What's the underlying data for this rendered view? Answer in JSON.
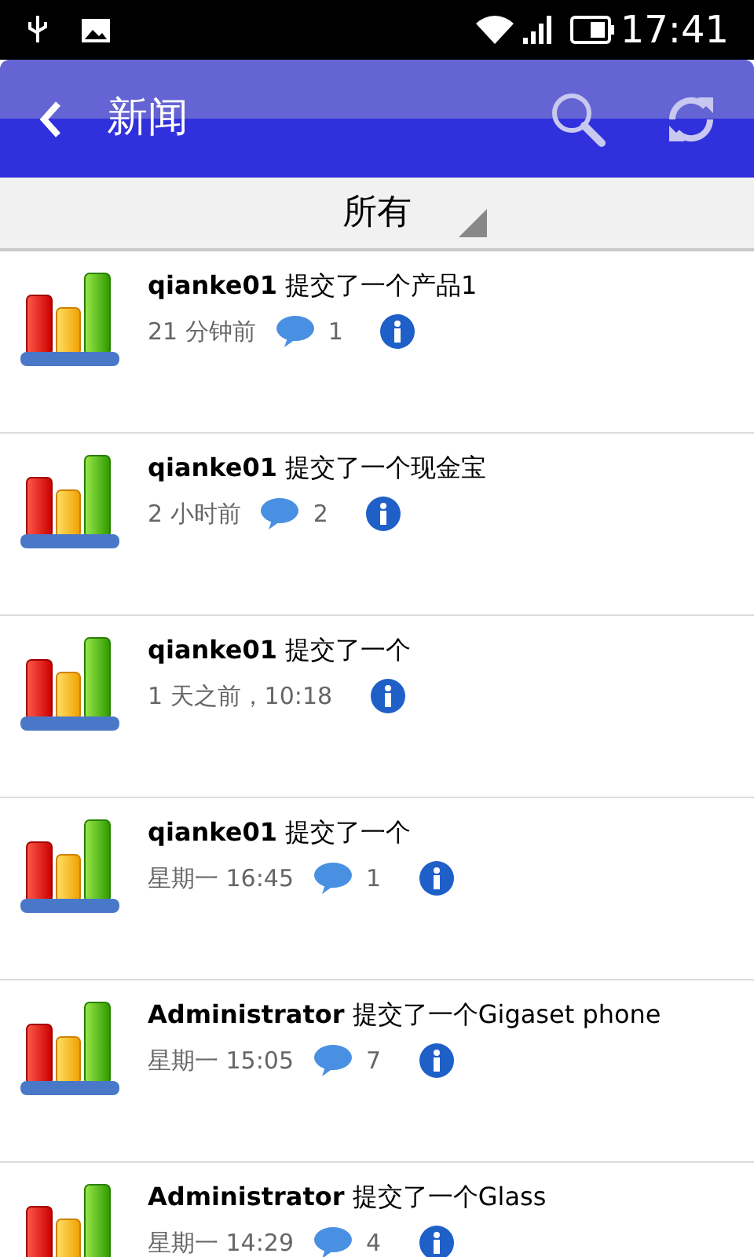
{
  "status_bar": {
    "time": "17:41"
  },
  "app_bar": {
    "title": "新闻"
  },
  "filter": {
    "value": "所有"
  },
  "items": [
    {
      "user": "qianke01",
      "action": "提交了一个产品1",
      "time": "21 分钟前",
      "comments": "1"
    },
    {
      "user": "qianke01",
      "action": "提交了一个现金宝",
      "time": "2 小时前",
      "comments": "2"
    },
    {
      "user": "qianke01",
      "action": "提交了一个",
      "time": "1 天之前，10:18"
    },
    {
      "user": "qianke01",
      "action": "提交了一个",
      "time": "星期一 16:45",
      "comments": "1"
    },
    {
      "user": "Administrator",
      "action": "提交了一个Gigaset phone",
      "time": "星期一 15:05",
      "comments": "7"
    },
    {
      "user": "Administrator",
      "action": "提交了一个Glass",
      "time": "星期一 14:29",
      "comments": "4"
    }
  ]
}
